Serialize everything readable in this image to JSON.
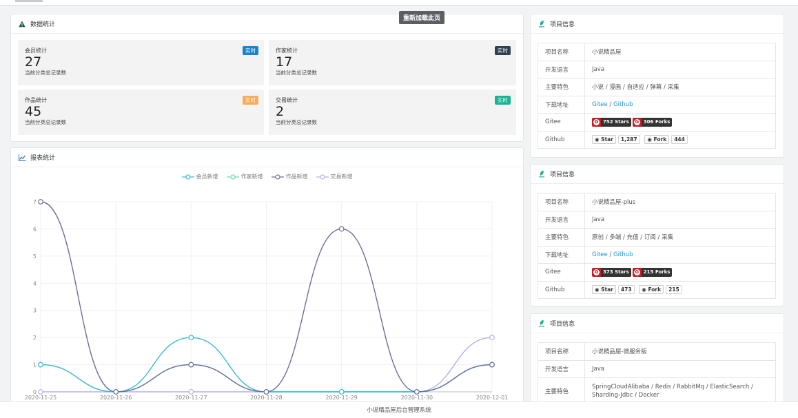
{
  "tooltip": "重新加载此页",
  "stats_panel": {
    "title": "数据统计",
    "boxes": [
      {
        "title": "会员统计",
        "badge": "实时",
        "badge_color": "#1c84c6",
        "value": "27",
        "desc": "当前分类总记录数"
      },
      {
        "title": "作家统计",
        "badge": "实时",
        "badge_color": "#2f4050",
        "value": "17",
        "desc": "当前分类总记录数"
      },
      {
        "title": "作品统计",
        "badge": "实时",
        "badge_color": "#f8ac59",
        "value": "45",
        "desc": "当前分类总记录数"
      },
      {
        "title": "交易统计",
        "badge": "实时",
        "badge_color": "#1ab394",
        "value": "2",
        "desc": "当前分类总记录数"
      }
    ]
  },
  "report_panel": {
    "title": "报表统计"
  },
  "chart_data": {
    "type": "line",
    "smooth": true,
    "categories": [
      "2020-11-25",
      "2020-11-26",
      "2020-11-27",
      "2020-11-28",
      "2020-11-29",
      "2020-11-30",
      "2020-12-01"
    ],
    "ylim": [
      0,
      7
    ],
    "yticks": [
      "0",
      "1",
      "2",
      "3",
      "4",
      "5",
      "6",
      "7"
    ],
    "grid": true,
    "legend_position": "top-center",
    "series": [
      {
        "name": "会员新增",
        "color": "#3db9d3",
        "values": [
          1,
          0,
          2,
          0,
          0,
          0,
          1
        ]
      },
      {
        "name": "作家新增",
        "color": "#5fd9b8",
        "values": [
          1,
          0,
          1,
          0,
          0,
          0,
          1
        ]
      },
      {
        "name": "作品新增",
        "color": "#6b6d9e",
        "values": [
          7,
          0,
          1,
          0,
          6,
          0,
          1
        ]
      },
      {
        "name": "交易新增",
        "color": "#b7aee4",
        "values": [
          0,
          0,
          0,
          0,
          0,
          0,
          2
        ]
      }
    ]
  },
  "projects": [
    {
      "title": "项目信息",
      "rows": {
        "name_label": "项目名称",
        "name": "小说精品屋",
        "lang_label": "开发语言",
        "lang": "Java",
        "feature_label": "主要特色",
        "feature": "小说 / 漫画 / 自适应 / 弹幕 / 采集",
        "download_label": "下载地址",
        "gitee_link": "Gitee",
        "sep": " / ",
        "github_link": "Github",
        "gitee_label": "Gitee",
        "gitee_stars": "752 Stars",
        "gitee_forks": "306 Forks",
        "github_label": "Github",
        "star_btn": "Star",
        "star_count": "1,287",
        "fork_btn": "Fork",
        "fork_count": "444"
      }
    },
    {
      "title": "项目信息",
      "rows": {
        "name_label": "项目名称",
        "name": "小说精品屋-plus",
        "lang_label": "开发语言",
        "lang": "Java",
        "feature_label": "主要特色",
        "feature": "原创 / 多端 / 充值 / 订阅 / 采集",
        "download_label": "下载地址",
        "gitee_link": "Gitee",
        "sep": " / ",
        "github_link": "Github",
        "gitee_label": "Gitee",
        "gitee_stars": "373 Stars",
        "gitee_forks": "215 Forks",
        "github_label": "Github",
        "star_btn": "Star",
        "star_count": "473",
        "fork_btn": "Fork",
        "fork_count": "215"
      }
    },
    {
      "title": "项目信息",
      "rows": {
        "name_label": "项目名称",
        "name": "小说精品屋-微服务版",
        "lang_label": "开发语言",
        "lang": "Java",
        "feature_label": "主要特色",
        "feature": "SpringCloudAlibaba / Redis / RabbitMq / ElasticSearch / Sharding-Jdbc / Docker"
      }
    }
  ],
  "footer": "小说精品屋后台管理系统"
}
